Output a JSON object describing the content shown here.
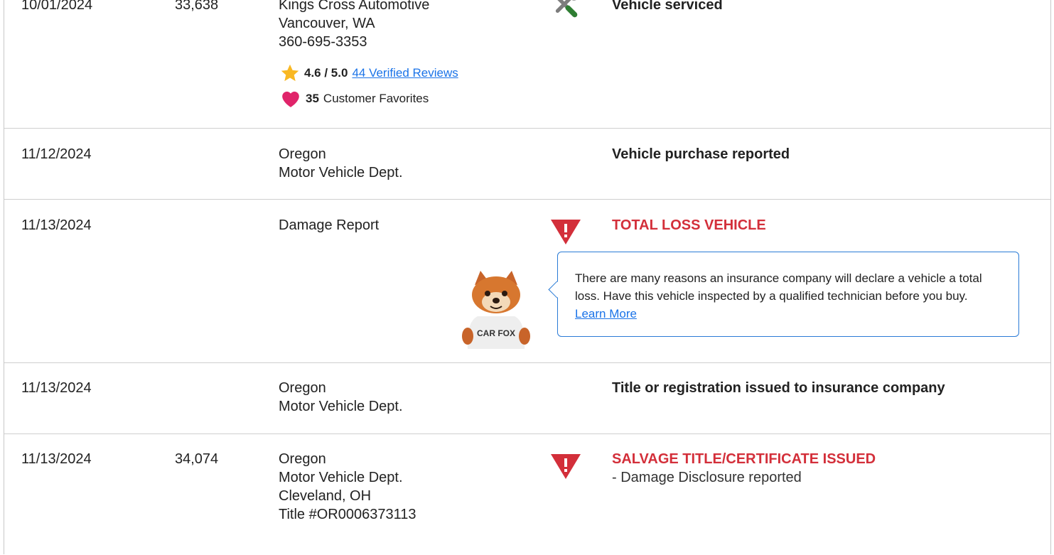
{
  "rows": [
    {
      "date": "10/01/2024",
      "mileage": "33,638",
      "source_lines": [
        "Kings Cross Automotive",
        "Vancouver, WA",
        "360-695-3353"
      ],
      "rating": "4.6 / 5.0",
      "reviews_link": "44 Verified Reviews",
      "favorites_count": "35",
      "favorites_label": "Customer Favorites",
      "icon": "wrench-screwdriver-icon",
      "comment": "Vehicle serviced"
    },
    {
      "date": "11/12/2024",
      "mileage": "",
      "source_lines": [
        "Oregon",
        "Motor Vehicle Dept."
      ],
      "comment": "Vehicle purchase reported"
    },
    {
      "date": "11/13/2024",
      "mileage": "",
      "source_lines": [
        "Damage Report"
      ],
      "icon": "warning-triangle-icon",
      "comment": "TOTAL LOSS VEHICLE",
      "callout_text": "There are many reasons an insurance company will declare a vehicle a total loss. Have this vehicle inspected by a qualified technician before you buy.",
      "callout_link": "Learn More",
      "mascot_shirt": "CAR FOX"
    },
    {
      "date": "11/13/2024",
      "mileage": "",
      "source_lines": [
        "Oregon",
        "Motor Vehicle Dept."
      ],
      "comment": "Title or registration issued to insurance company"
    },
    {
      "date": "11/13/2024",
      "mileage": "34,074",
      "source_lines": [
        "Oregon",
        "Motor Vehicle Dept.",
        "Cleveland, OH",
        "Title #OR0006373113"
      ],
      "icon": "warning-triangle-icon",
      "comment": "SALVAGE TITLE/CERTIFICATE ISSUED",
      "sub_comment": "- Damage Disclosure reported"
    }
  ],
  "colors": {
    "alert": "#d32f3a",
    "link": "#1a73e8",
    "callout_border": "#2a7bd6",
    "star": "#f9b823",
    "heart": "#e0246a"
  }
}
